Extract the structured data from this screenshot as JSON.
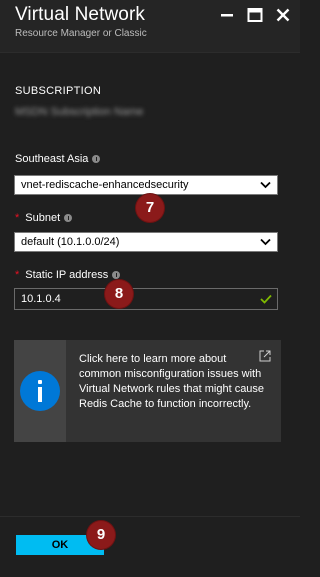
{
  "header": {
    "title": "Virtual Network",
    "subtitle": "Resource Manager or Classic"
  },
  "subscription": {
    "label": "SUBSCRIPTION",
    "value": "MSDN Subscription Name"
  },
  "vnet": {
    "label": "Southeast Asia",
    "selected": "vnet-rediscache-enhancedsecurity"
  },
  "subnet": {
    "required_mark": "*",
    "label": "Subnet",
    "selected": "default (10.1.0.0/24)"
  },
  "static_ip": {
    "required_mark": "*",
    "label": "Static IP address",
    "value": "10.1.0.4"
  },
  "info_box": {
    "text": "Click here to learn more about common misconfiguration issues with Virtual Network rules that might cause Redis Cache to function incorrectly."
  },
  "badges": {
    "b7": "7",
    "b8": "8",
    "b9": "9"
  },
  "footer": {
    "ok_label": "OK"
  },
  "colors": {
    "accent": "#00bcf2",
    "info_blue": "#0078d7",
    "badge_red": "#8b1a1a",
    "required_red": "#e81123",
    "valid_green": "#7fba00"
  }
}
